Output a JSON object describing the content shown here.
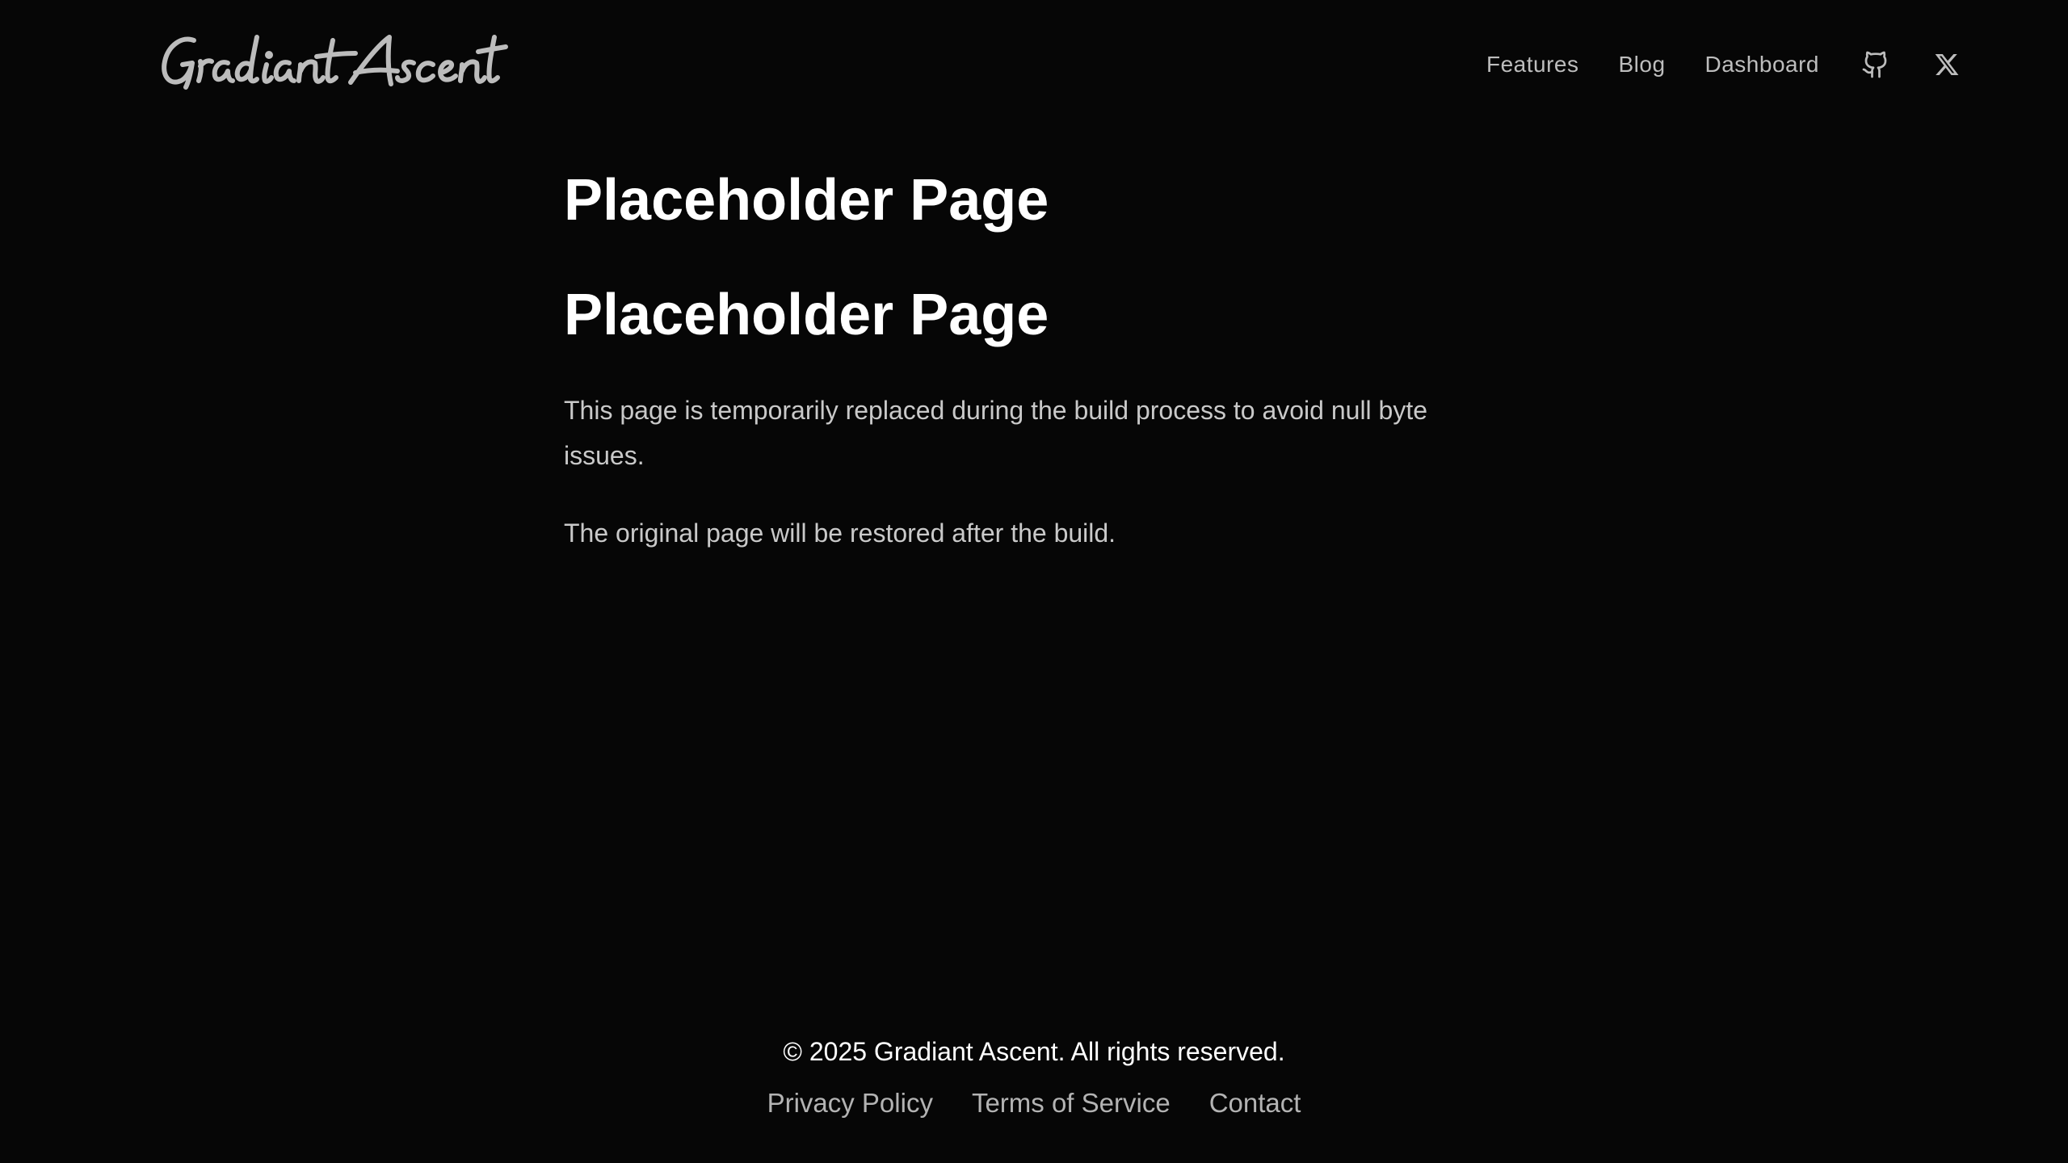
{
  "header": {
    "logo_text": "Gradiant Ascent",
    "nav": {
      "features": "Features",
      "blog": "Blog",
      "dashboard": "Dashboard"
    },
    "icons": [
      "github-icon",
      "x-twitter-icon"
    ]
  },
  "main": {
    "title": "Placeholder Page",
    "subtitle": "Placeholder Page",
    "paragraph_1": "This page is temporarily replaced during the build process to avoid null byte issues.",
    "paragraph_2": "The original page will be restored after the build."
  },
  "footer": {
    "copyright": "© 2025 Gradiant Ascent. All rights reserved.",
    "links": {
      "privacy": "Privacy Policy",
      "terms": "Terms of Service",
      "contact": "Contact"
    }
  },
  "colors": {
    "background": "#060606",
    "heading": "#ffffff",
    "body_text": "#c9c9c9",
    "nav_text": "#bdbdbd",
    "logo": "#bcbcbc"
  }
}
